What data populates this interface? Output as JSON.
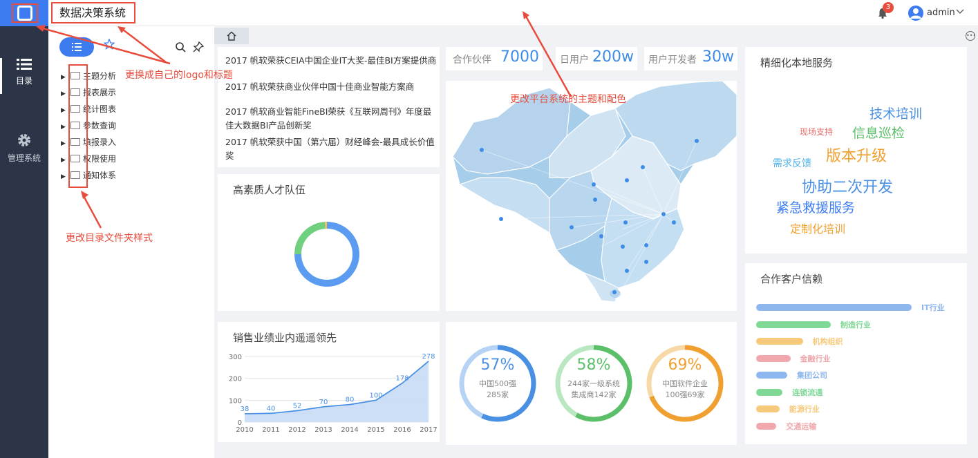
{
  "app": {
    "title": "数据决策系统"
  },
  "header": {
    "notifications": "3",
    "user": "admin"
  },
  "nav": {
    "items": [
      {
        "label": "目录"
      },
      {
        "label": "管理系统"
      }
    ]
  },
  "tree": {
    "items": [
      {
        "label": "主题分析"
      },
      {
        "label": "报表展示"
      },
      {
        "label": "统计图表"
      },
      {
        "label": "参数查询"
      },
      {
        "label": "填报录入"
      },
      {
        "label": "权限使用"
      },
      {
        "label": "通知体系"
      }
    ]
  },
  "annotations": {
    "logo": "更换成自己的logo和标题",
    "folder": "更改目录文件夹样式",
    "theme": "更改平台系统的主题和配色"
  },
  "news": [
    "2017 帆软荣获CEIA中国企业IT大奖-最佳BI方案提供商",
    "2017 帆软荣获商业伙伴中国十佳商业智能方案商",
    "2017 帆软商业智能FineBI荣获《互联网周刊》年度最佳大数据BI产品创新奖",
    "2017 帆软荣获中国（第六届）财经峰会-最具成长价值奖"
  ],
  "stats": [
    {
      "label": "合作伙伴",
      "value": "7000"
    },
    {
      "label": "日用户",
      "value": "200w"
    },
    {
      "label": "用户开发者",
      "value": "30w"
    }
  ],
  "talent": {
    "title": "高素质人才队伍"
  },
  "sales": {
    "title": "销售业绩业内遥遥领先"
  },
  "service": {
    "title": "精细化本地服务",
    "words": [
      {
        "text": "技术培训",
        "color": "#4a90e2"
      },
      {
        "text": "现场支持",
        "color": "#e86b6b"
      },
      {
        "text": "信息巡检",
        "color": "#5cc06a"
      },
      {
        "text": "需求反馈",
        "color": "#4fb3e8"
      },
      {
        "text": "版本升级",
        "color": "#f0a030"
      },
      {
        "text": "协助二次开发",
        "color": "#4a90e2"
      },
      {
        "text": "紧急救援服务",
        "color": "#3d7cf0"
      },
      {
        "text": "定制化培训",
        "color": "#f0a030"
      }
    ]
  },
  "customers": {
    "title": "合作客户信赖",
    "items": [
      {
        "label": "IT行业",
        "value": 1.0,
        "color": "#8db7ee"
      },
      {
        "label": "制造行业",
        "value": 0.48,
        "color": "#7ed896"
      },
      {
        "label": "机构组织",
        "value": 0.3,
        "color": "#f7c97a"
      },
      {
        "label": "金融行业",
        "value": 0.22,
        "color": "#f0a8ac"
      },
      {
        "label": "集团公司",
        "value": 0.2,
        "color": "#8db7ee"
      },
      {
        "label": "连锁流通",
        "value": 0.17,
        "color": "#7ed896"
      },
      {
        "label": "能源行业",
        "value": 0.15,
        "color": "#f7c97a"
      },
      {
        "label": "交通运输",
        "value": 0.13,
        "color": "#f0a8ac"
      }
    ]
  },
  "rings": [
    {
      "pct": "57%",
      "line1": "中国500强",
      "line2": "285家",
      "value": 0.57,
      "color": "#4a90e2",
      "light": "#b6d3f5"
    },
    {
      "pct": "58%",
      "line1": "244家一级系统",
      "line2": "集成商142家",
      "value": 0.58,
      "color": "#5cc06a",
      "light": "#b9e7c1"
    },
    {
      "pct": "69%",
      "line1": "中国软件企业",
      "line2": "100强69家",
      "value": 0.69,
      "color": "#f0a030",
      "light": "#f7d9a8"
    }
  ],
  "chart_data": [
    {
      "type": "area",
      "x": [
        "2010",
        "2011",
        "2012",
        "2013",
        "2014",
        "2015",
        "2016",
        "2017"
      ],
      "series": [
        {
          "values": [
            38,
            40,
            52,
            70,
            80,
            100,
            178,
            278
          ]
        }
      ],
      "ylim": [
        0,
        300
      ],
      "yticks": [
        "0",
        "100",
        "200",
        "300"
      ],
      "grid": true,
      "color": "#4a90e2"
    },
    {
      "type": "pie",
      "values": [
        0.75,
        0.24,
        0.01
      ],
      "colors": [
        "#5b9cf0",
        "#6fd07f",
        "#f5c050"
      ]
    }
  ]
}
